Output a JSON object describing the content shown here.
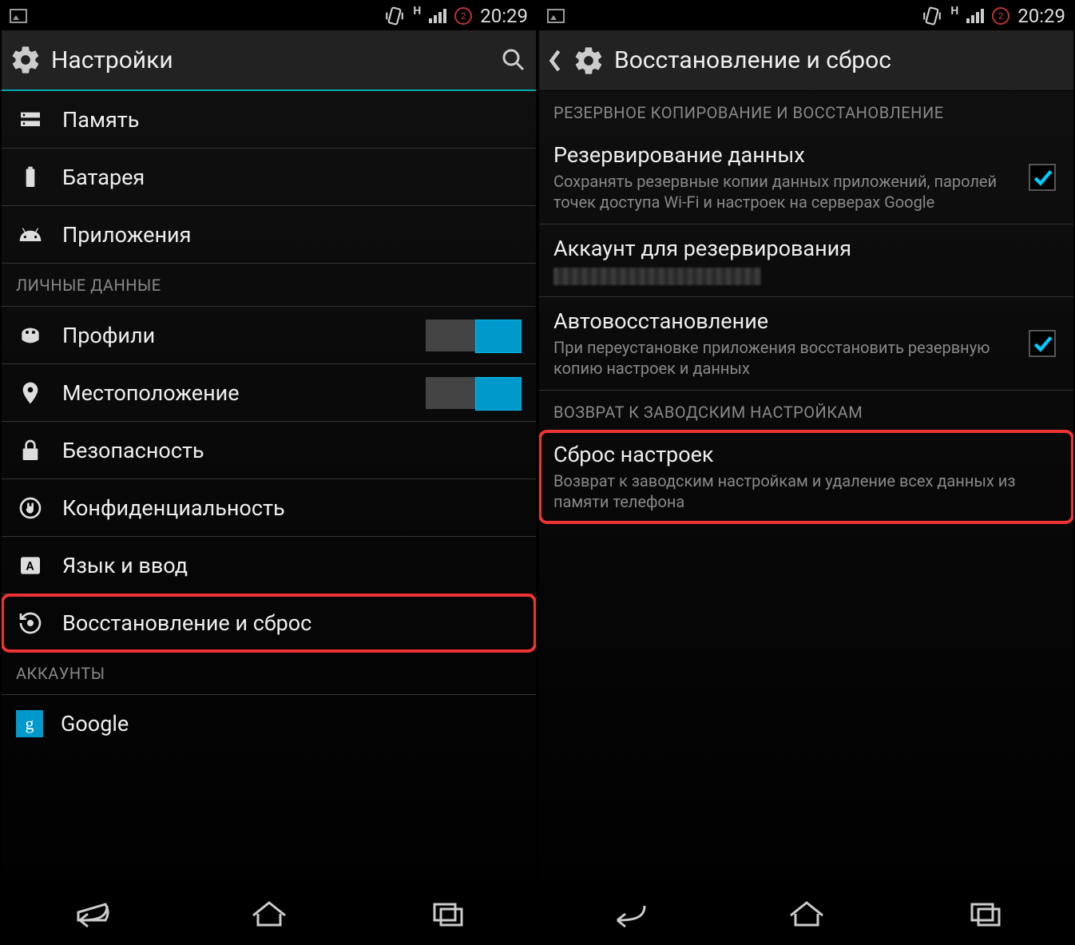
{
  "status": {
    "time": "20:29",
    "h": "H",
    "sim": "2"
  },
  "left": {
    "appbar_title": "Настройки",
    "items": {
      "memory": "Память",
      "battery": "Батарея",
      "apps": "Приложения"
    },
    "section_personal": "ЛИЧНЫЕ ДАННЫЕ",
    "personal": {
      "profiles": "Профили",
      "location": "Местоположение",
      "security": "Безопасность",
      "privacy": "Конфиденциальность",
      "language": "Язык и ввод",
      "backup_reset": "Восстановление и сброс"
    },
    "section_accounts": "АККАУНТЫ",
    "accounts": {
      "google": "Google"
    }
  },
  "right": {
    "appbar_title": "Восстановление и сброс",
    "section_backup": "РЕЗЕРВНОЕ КОПИРОВАНИЕ И ВОССТАНОВЛЕНИЕ",
    "backup_data": {
      "title": "Резервирование данных",
      "subtitle": "Сохранять резервные копии данных приложений, паролей точек доступа Wi-Fi и настроек на серверах Google"
    },
    "backup_account": {
      "title": "Аккаунт для резервирования"
    },
    "auto_restore": {
      "title": "Автовосстановление",
      "subtitle": "При переустановке приложения восстановить резервную копию настроек и данных"
    },
    "section_factory": "ВОЗВРАТ К ЗАВОДСКИМ НАСТРОЙКАМ",
    "factory_reset": {
      "title": "Сброс настроек",
      "subtitle": "Возврат к заводским настройкам и удаление всех данных из памяти телефона"
    }
  }
}
